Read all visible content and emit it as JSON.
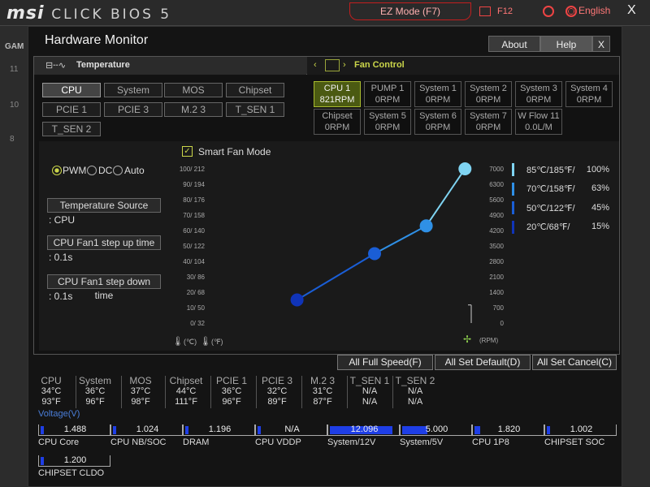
{
  "topbar": {
    "brand": "msi",
    "bios_name": "CLICK BIOS 5",
    "ez_mode": "EZ Mode (F7)",
    "f12": "F12",
    "language": "English",
    "close": "X"
  },
  "background_left": [
    "GAM",
    "11",
    "10",
    "8"
  ],
  "window": {
    "title": "Hardware Monitor",
    "about": "About",
    "help": "Help",
    "close": "X"
  },
  "temperature_tab": {
    "label": "Temperature",
    "icon": "temperature-graph-icon",
    "sensors": [
      "CPU",
      "System",
      "MOS",
      "Chipset",
      "PCIE 1",
      "PCIE 3",
      "M.2 3",
      "T_SEN 1",
      "T_SEN 2"
    ],
    "selected": "CPU"
  },
  "fan_tab": {
    "label": "Fan Control",
    "icon": "fan-chart-icon",
    "fans": [
      {
        "name": "CPU 1",
        "value": "821RPM"
      },
      {
        "name": "PUMP 1",
        "value": "0RPM"
      },
      {
        "name": "System 1",
        "value": "0RPM"
      },
      {
        "name": "System 2",
        "value": "0RPM"
      },
      {
        "name": "System 3",
        "value": "0RPM"
      },
      {
        "name": "System 4",
        "value": "0RPM"
      },
      {
        "name": "Chipset",
        "value": "0RPM"
      },
      {
        "name": "System 5",
        "value": "0RPM"
      },
      {
        "name": "System 6",
        "value": "0RPM"
      },
      {
        "name": "System 7",
        "value": "0RPM"
      },
      {
        "name": "W Flow 11",
        "value": "0.0L/M"
      }
    ],
    "selected": "CPU 1"
  },
  "smart_fan": {
    "checkbox_label": "Smart Fan Mode",
    "checked": true,
    "modes": [
      "PWM",
      "DC",
      "Auto"
    ],
    "selected_mode": "PWM",
    "temperature_source_label": "Temperature Source",
    "temperature_source_value": ": CPU",
    "step_up_label": "CPU Fan1 step up time",
    "step_up_value": ": 0.1s",
    "step_down_label": "CPU Fan1 step down time",
    "step_down_value": ": 0.1s"
  },
  "chart_data": {
    "type": "line",
    "y_left_ticks": [
      "100/ 212",
      "90/ 194",
      "80/ 176",
      "70/ 158",
      "60/ 140",
      "50/ 122",
      "40/ 104",
      "30/  86",
      "20/  68",
      "10/  50",
      "0/  32"
    ],
    "y_right_ticks": [
      "7000",
      "6300",
      "5600",
      "4900",
      "4200",
      "3500",
      "2800",
      "2100",
      "1400",
      "700",
      "0"
    ],
    "xlabel_c": "(℃)",
    "xlabel_f": "(℉)",
    "ylabel_right": "(RPM)",
    "series": [
      {
        "temp_c": 20,
        "percent": 15,
        "color": "#1034b8"
      },
      {
        "temp_c": 50,
        "percent": 45,
        "color": "#1a5ed6"
      },
      {
        "temp_c": 70,
        "percent": 63,
        "color": "#2f90e6"
      },
      {
        "temp_c": 85,
        "percent": 100,
        "color": "#7fd4f2"
      }
    ],
    "current_rpm": 821
  },
  "legend": [
    {
      "temp": "85℃/185℉/",
      "pct": "100%",
      "color": "#7fd4f2"
    },
    {
      "temp": "70℃/158℉/",
      "pct": "63%",
      "color": "#2f90e6"
    },
    {
      "temp": "50℃/122℉/",
      "pct": "45%",
      "color": "#1a5ed6"
    },
    {
      "temp": "20℃/68℉/",
      "pct": "15%",
      "color": "#1034b8"
    }
  ],
  "actions": {
    "full_speed": "All Full Speed(F)",
    "set_default": "All Set Default(D)",
    "set_cancel": "All Set Cancel(C)"
  },
  "temps": [
    {
      "name": "CPU",
      "c": "34°C",
      "f": "93°F"
    },
    {
      "name": "System",
      "c": "36°C",
      "f": "96°F"
    },
    {
      "name": "MOS",
      "c": "37°C",
      "f": "98°F"
    },
    {
      "name": "Chipset",
      "c": "44°C",
      "f": "111°F"
    },
    {
      "name": "PCIE 1",
      "c": "36°C",
      "f": "96°F"
    },
    {
      "name": "PCIE 3",
      "c": "32°C",
      "f": "89°F"
    },
    {
      "name": "M.2 3",
      "c": "31°C",
      "f": "87°F"
    },
    {
      "name": "T_SEN 1",
      "c": "N/A",
      "f": "N/A"
    },
    {
      "name": "T_SEN 2",
      "c": "N/A",
      "f": "N/A"
    }
  ],
  "voltage_title": "Voltage(V)",
  "voltages": [
    {
      "name": "CPU Core",
      "value": "1.488",
      "fill": 0.05
    },
    {
      "name": "CPU NB/SOC",
      "value": "1.024",
      "fill": 0.05
    },
    {
      "name": "DRAM",
      "value": "1.196",
      "fill": 0.05
    },
    {
      "name": "CPU VDDP",
      "value": "N/A",
      "fill": 0
    },
    {
      "name": "System/12V",
      "value": "12.096",
      "fill": 0.9
    },
    {
      "name": "System/5V",
      "value": "5.000",
      "fill": 0.36
    },
    {
      "name": "CPU 1P8",
      "value": "1.820",
      "fill": 0.08
    },
    {
      "name": "CHIPSET SOC",
      "value": "1.002",
      "fill": 0.05
    },
    {
      "name": "CHIPSET CLDO",
      "value": "1.200",
      "fill": 0.05
    }
  ]
}
